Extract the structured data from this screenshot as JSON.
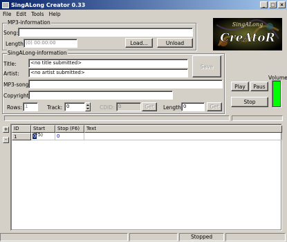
{
  "window": {
    "title": "SingALong Creator 0.33"
  },
  "menu": [
    {
      "label": "File"
    },
    {
      "label": "Edit"
    },
    {
      "label": "Tools"
    },
    {
      "label": "Help"
    }
  ],
  "mp3": {
    "group_label": "MP3-information",
    "song_label": "Song:",
    "song_value": "",
    "length_label": "Length:",
    "length_value": "(0) 00:00:00",
    "load_button": "Load...",
    "unload_button": "Unload"
  },
  "logo": {
    "text_top": "SingALong",
    "text_main": "CreAtoR"
  },
  "singalong": {
    "group_label": "SingALong-information",
    "title_label": "Title:",
    "title_value": "<no title submitted>",
    "artist_label": "Artist:",
    "artist_value": "<no artist submitted>",
    "save_button": "Save",
    "mp3song_label": "MP3-song:",
    "mp3song_value": "",
    "copyright_label": "Copyright:",
    "copyright_value": "",
    "rows_label": "Rows:",
    "rows_value": "1",
    "track_label": "Track:",
    "track_value": "0",
    "cdid_label": "CDID:",
    "cdid_value": "0",
    "get_button_1": "Get",
    "length_label": "Length:",
    "length_value": "0",
    "get_button_2": "Get"
  },
  "player": {
    "volume_label": "Volume",
    "play_button": "Play",
    "pause_button": "Paus",
    "stop_button": "Stop",
    "volume_level": 1.0,
    "volume_color": "#00ff00"
  },
  "progress": {
    "value": 0
  },
  "grid": {
    "columns": [
      "ID",
      "Start (F5)",
      "Stop (F6)",
      "Text"
    ],
    "rows": [
      {
        "id": "1",
        "start": "0",
        "stop": "0",
        "text": ""
      }
    ],
    "add_button": "+",
    "remove_button": "-"
  },
  "status": {
    "text": "Stopped"
  }
}
